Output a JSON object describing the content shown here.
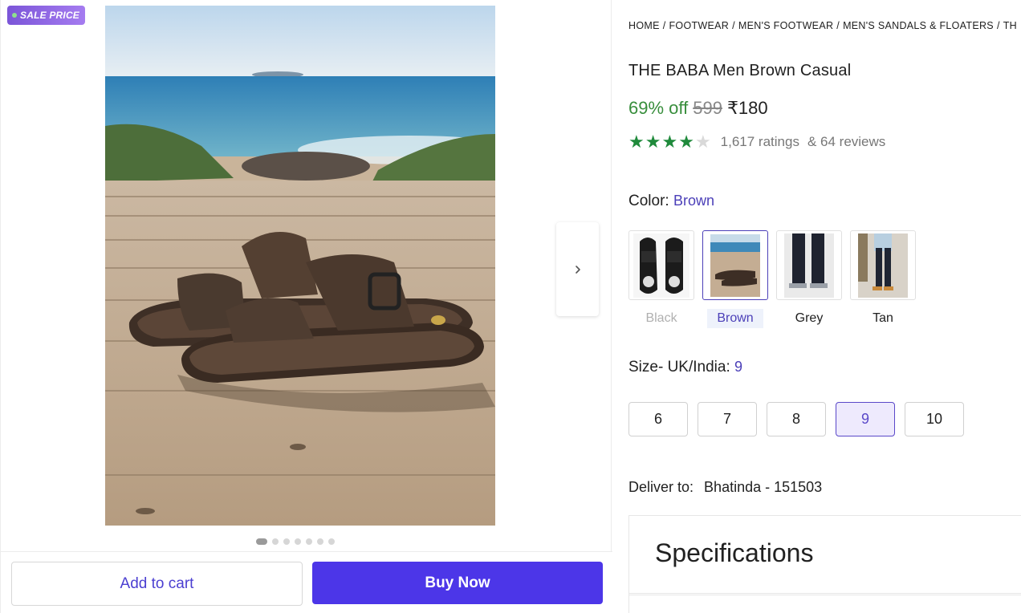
{
  "badge": {
    "label": "SALE PRICE"
  },
  "gallery": {
    "dot_count": 7,
    "active_dot": 0
  },
  "actions": {
    "add_to_cart": "Add to cart",
    "buy_now": "Buy Now"
  },
  "breadcrumb": [
    "HOME",
    "FOOTWEAR",
    "MEN'S FOOTWEAR",
    "MEN'S SANDALS & FLOATERS",
    "TH"
  ],
  "product": {
    "title": "THE BABA Men Brown Casual",
    "discount": "69% off",
    "mrp": "599",
    "price": "₹180",
    "rating": 4,
    "ratings_count": "1,617 ratings",
    "reviews_count": "& 64 reviews"
  },
  "color": {
    "label": "Color:",
    "selected": "Brown",
    "options": [
      {
        "name": "Black",
        "state": "disabled"
      },
      {
        "name": "Brown",
        "state": "selected"
      },
      {
        "name": "Grey",
        "state": "normal"
      },
      {
        "name": "Tan",
        "state": "normal"
      }
    ]
  },
  "size": {
    "label": "Size- UK/India:",
    "selected": "9",
    "options": [
      "6",
      "7",
      "8",
      "9",
      "10"
    ]
  },
  "delivery": {
    "label": "Deliver to:",
    "place": "Bhatinda - 151503"
  },
  "specs": {
    "title": "Specifications"
  },
  "colors": {
    "accent": "#4c36e8",
    "discount": "#388e3c",
    "star": "#1f8a3b",
    "selected_text": "#4b3fb8"
  }
}
